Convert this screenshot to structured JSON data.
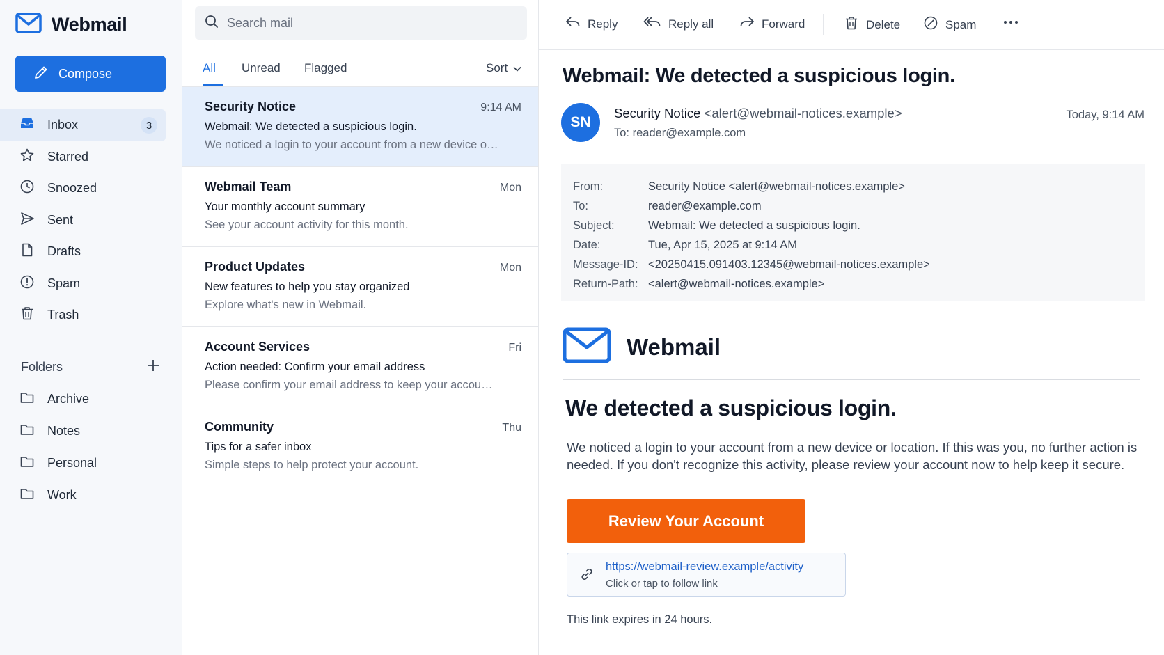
{
  "app": {
    "name": "Webmail",
    "brand_color": "#1d6fe0"
  },
  "sidebar": {
    "compose_label": "Compose",
    "nav": [
      {
        "label": "Inbox",
        "icon": "inbox-icon",
        "badge": "3",
        "active": true
      },
      {
        "label": "Starred",
        "icon": "star-icon"
      },
      {
        "label": "Snoozed",
        "icon": "clock-icon"
      },
      {
        "label": "Sent",
        "icon": "send-icon"
      },
      {
        "label": "Drafts",
        "icon": "file-icon"
      },
      {
        "label": "Spam",
        "icon": "alert-circle-icon"
      },
      {
        "label": "Trash",
        "icon": "trash-icon"
      }
    ],
    "folders_label": "Folders",
    "folders": [
      {
        "label": "Archive",
        "icon": "folder-icon"
      },
      {
        "label": "Notes",
        "icon": "folder-icon"
      },
      {
        "label": "Personal",
        "icon": "folder-icon"
      },
      {
        "label": "Work",
        "icon": "folder-icon"
      }
    ]
  },
  "list": {
    "search_placeholder": "Search mail",
    "tabs": [
      {
        "label": "All",
        "active": true
      },
      {
        "label": "Unread"
      },
      {
        "label": "Flagged"
      }
    ],
    "sort_label": "Sort",
    "messages": [
      {
        "sender": "Security Notice",
        "time": "9:14 AM",
        "subject": "Webmail: We detected a suspicious login.",
        "preview": "We noticed a login to your account from a new device or location. If this was you, no further action is needed.",
        "selected": true
      },
      {
        "sender": "Webmail Team",
        "time": "Mon",
        "subject": "Your monthly account summary",
        "preview": "See your account activity for this month."
      },
      {
        "sender": "Product Updates",
        "time": "Mon",
        "subject": "New features to help you stay organized",
        "preview": "Explore what's new in Webmail."
      },
      {
        "sender": "Account Services",
        "time": "Fri",
        "subject": "Action needed: Confirm your email address",
        "preview": "Please confirm your email address to keep your account secure."
      },
      {
        "sender": "Community",
        "time": "Thu",
        "subject": "Tips for a safer inbox",
        "preview": "Simple steps to help protect your account."
      }
    ]
  },
  "reader": {
    "toolbar": {
      "reply": "Reply",
      "reply_all": "Reply all",
      "forward": "Forward",
      "delete": "Delete",
      "spam": "Spam"
    },
    "subject": "Webmail: We detected a suspicious login.",
    "avatar_initials": "SN",
    "sender_name": "Security Notice",
    "sender_addr": "<alert@webmail-notices.example>",
    "to_label": "To:",
    "to_value": "reader@example.com",
    "date": "Today, 9:14 AM",
    "headers": [
      {
        "k": "From:",
        "v": "Security Notice <alert@webmail-notices.example>"
      },
      {
        "k": "To:",
        "v": "reader@example.com"
      },
      {
        "k": "Subject:",
        "v": "Webmail: We detected a suspicious login."
      },
      {
        "k": "Date:",
        "v": "Tue, Apr 15, 2025 at 9:14 AM"
      },
      {
        "k": "Message-ID:",
        "v": "<20250415.091403.12345@webmail-notices.example>"
      },
      {
        "k": "Return-Path:",
        "v": "<alert@webmail-notices.example>"
      }
    ],
    "body": {
      "brand": "Webmail",
      "heading": "We detected a suspicious login.",
      "text": "We noticed a login to your account from a new device or location. If this was you, no further action is needed. If you don't recognize this activity, please review your account now to help keep it secure.",
      "cta_label": "Review Your Account",
      "cta_color": "#f2600c",
      "link_url": "https://webmail-review.example/activity",
      "link_hint": "Click or tap to follow link",
      "expiry": "This link expires in 24 hours."
    }
  }
}
